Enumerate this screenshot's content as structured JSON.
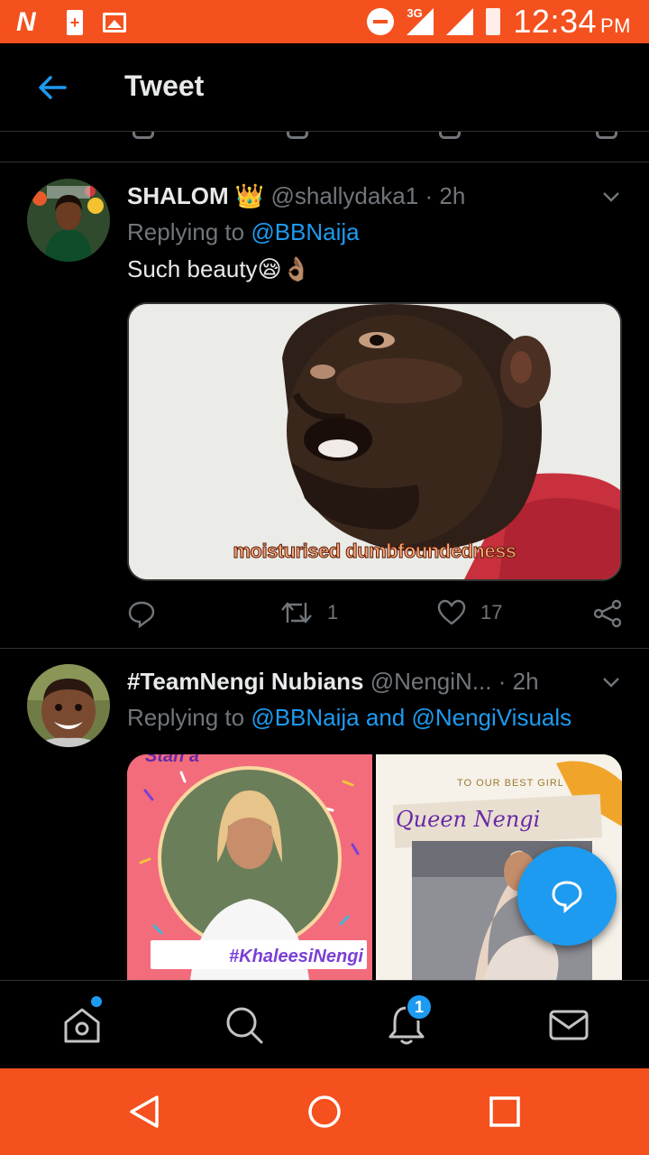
{
  "status_bar": {
    "time": "12:34",
    "ampm": "PM",
    "network": "3G",
    "app_letter": "N"
  },
  "header": {
    "title": "Tweet"
  },
  "tweets": [
    {
      "name": "SHALOM",
      "name_emoji": "👑",
      "handle": "@shallydaka1",
      "dot": "·",
      "time": "2h",
      "replying_prefix": "Replying to",
      "replying_to": "@BBNaija",
      "text": "Such beauty😪👌🏽",
      "media_caption": "moisturised dumbfoundedness",
      "retweets": "1",
      "likes": "17"
    },
    {
      "name": "#TeamNengi Nubians",
      "handle": "@NengiN...",
      "dot": "·",
      "time": "2h",
      "replying_prefix": "Replying to",
      "replying_to": "@BBNaija and @NengiVisuals",
      "media": [
        {
          "hashtag": "#KhaleesiNengi"
        },
        {
          "top_text": "TO OUR BEST GIRL",
          "title": "Queen Nengi"
        }
      ]
    }
  ],
  "bottom_nav": {
    "notifications_badge": "1"
  },
  "colors": {
    "accent": "#1d9bf0",
    "system_bar": "#f4511e",
    "muted": "#71767b"
  }
}
